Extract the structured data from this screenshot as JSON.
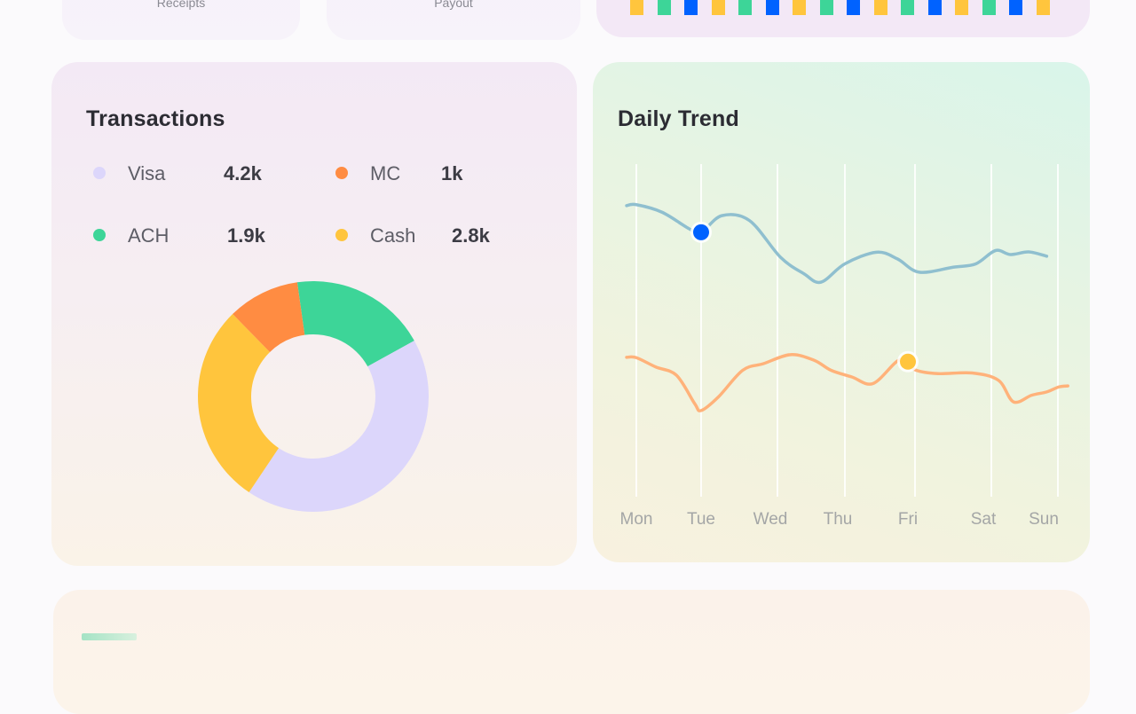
{
  "top_cards": {
    "receipts_label": "Receipts",
    "payout_label": "Payout"
  },
  "bar_strip": {
    "colors": [
      "#ffc53d",
      "#3dd598",
      "#0062ff",
      "#ffc53d",
      "#3dd598",
      "#0062ff",
      "#ffc53d",
      "#3dd598",
      "#0062ff",
      "#ffc53d",
      "#3dd598",
      "#0062ff",
      "#ffc53d",
      "#3dd598",
      "#0062ff",
      "#ffc53d"
    ]
  },
  "transactions": {
    "title": "Transactions",
    "legend": [
      {
        "label": "Visa",
        "value": "4.2k",
        "color": "#dcd6fb"
      },
      {
        "label": "MC",
        "value": "1k",
        "color": "#ff8c42"
      },
      {
        "label": "ACH",
        "value": "1.9k",
        "color": "#3dd598"
      },
      {
        "label": "Cash",
        "value": "2.8k",
        "color": "#ffc53d"
      }
    ]
  },
  "daily_trend": {
    "title": "Daily Trend"
  },
  "bottom_card": {
    "tag_color": "#7fdcb5"
  },
  "chart_data": [
    {
      "type": "pie",
      "title": "Transactions",
      "donut": true,
      "categories": [
        "ACH",
        "Visa",
        "Cash",
        "MC"
      ],
      "values": [
        1.9,
        4.2,
        2.8,
        1.0
      ],
      "units": "thousands",
      "colors": [
        "#3dd598",
        "#dcd6fb",
        "#ffc53d",
        "#ff8c42"
      ],
      "legend_position": "top"
    },
    {
      "type": "line",
      "title": "Daily Trend",
      "xlabel": "",
      "ylabel": "",
      "categories": [
        "Mon",
        "Tue",
        "Wed",
        "Thu",
        "Fri",
        "Sat",
        "Sun"
      ],
      "x_range": [
        0,
        6
      ],
      "ylim": [
        0,
        100
      ],
      "grid": "vertical",
      "series": [
        {
          "name": "series-blue",
          "color": "#8fbfcf",
          "marker_color": "#0062ff",
          "marker_at": 1,
          "points": [
            [
              -0.15,
              87.5
            ],
            [
              0.0,
              87.8
            ],
            [
              0.4,
              85.5
            ],
            [
              0.82,
              80.5
            ],
            [
              1.0,
              79.5
            ],
            [
              1.3,
              84.5
            ],
            [
              1.7,
              83.0
            ],
            [
              2.15,
              72.0
            ],
            [
              2.5,
              67.0
            ],
            [
              2.75,
              64.5
            ],
            [
              3.1,
              70.0
            ],
            [
              3.55,
              73.5
            ],
            [
              3.85,
              71.5
            ],
            [
              4.15,
              67.5
            ],
            [
              4.6,
              69.0
            ],
            [
              4.9,
              70.0
            ],
            [
              5.2,
              74.0
            ],
            [
              5.45,
              72.8
            ],
            [
              5.75,
              73.6
            ],
            [
              6.05,
              72.3
            ]
          ]
        },
        {
          "name": "series-orange",
          "color": "#ffb27a",
          "marker_color": "#ffc53d",
          "marker_at": 4,
          "points": [
            [
              -0.15,
              41.9
            ],
            [
              0.0,
              41.8
            ],
            [
              0.3,
              39.0
            ],
            [
              0.62,
              36.5
            ],
            [
              0.9,
              28.0
            ],
            [
              1.0,
              25.9
            ],
            [
              1.25,
              30.0
            ],
            [
              1.6,
              38.0
            ],
            [
              1.9,
              40.0
            ],
            [
              2.3,
              42.7
            ],
            [
              2.65,
              41.0
            ],
            [
              2.9,
              38.0
            ],
            [
              3.2,
              36.0
            ],
            [
              3.5,
              34.0
            ],
            [
              3.85,
              40.8
            ],
            [
              4.0,
              40.6
            ],
            [
              4.1,
              38.1
            ],
            [
              4.4,
              37.0
            ],
            [
              4.85,
              37.2
            ],
            [
              5.25,
              35.0
            ],
            [
              5.5,
              28.5
            ],
            [
              5.8,
              30.5
            ],
            [
              6.05,
              31.5
            ],
            [
              6.25,
              33.0
            ],
            [
              6.4,
              33.3
            ]
          ]
        }
      ]
    }
  ]
}
